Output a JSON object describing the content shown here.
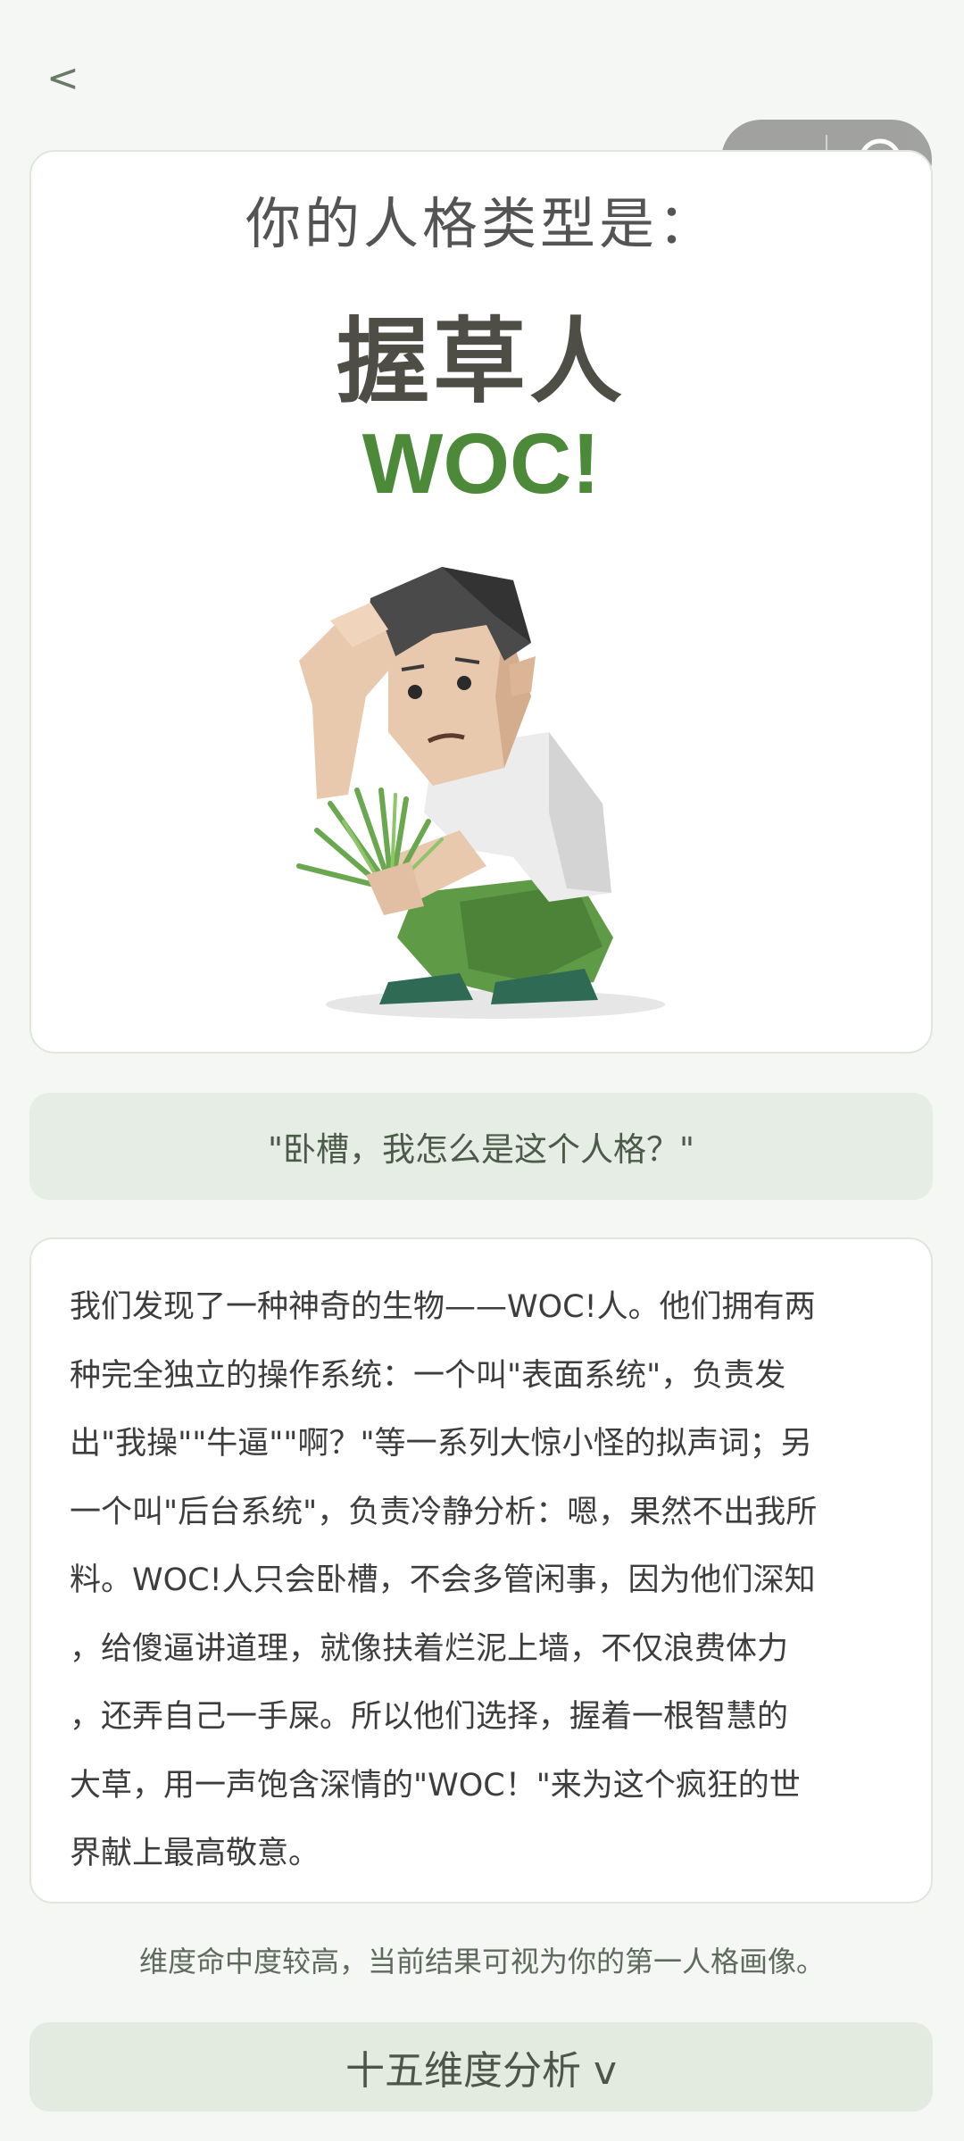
{
  "nav": {
    "back_label": "<"
  },
  "capsule": {
    "more_icon": "more-dots-icon",
    "close_icon": "target-close-icon"
  },
  "result": {
    "label": "你的人格类型是：",
    "type_name": "握草人",
    "type_code": "WOC!",
    "illustration_icon": "crouching-man-holding-grass-illustration",
    "accent_color": "#4c8a3a"
  },
  "quote": "\"卧槽，我怎么是这个人格？\"",
  "description_lines": [
    "我们发现了一种神奇的生物——WOC!人。他们拥有两",
    "种完全独立的操作系统：一个叫\"表面系统\"，负责发",
    "出\"我操\"\"牛逼\"\"啊？\"等一系列大惊小怪的拟声词；另",
    "一个叫\"后台系统\"，负责冷静分析：嗯，果然不出我所",
    "料。WOC!人只会卧槽，不会多管闲事，因为他们深知",
    "，给傻逼讲道理，就像扶着烂泥上墙，不仅浪费体力",
    "，还弄自己一手屎。所以他们选择，握着一根智慧的",
    "大草，用一声饱含深情的\"WOC！\"来为这个疯狂的世",
    "界献上最高敬意。"
  ],
  "note": "维度命中度较高，当前结果可视为你的第一人格画像。",
  "expand_button": {
    "label": "十五维度分析 v"
  }
}
